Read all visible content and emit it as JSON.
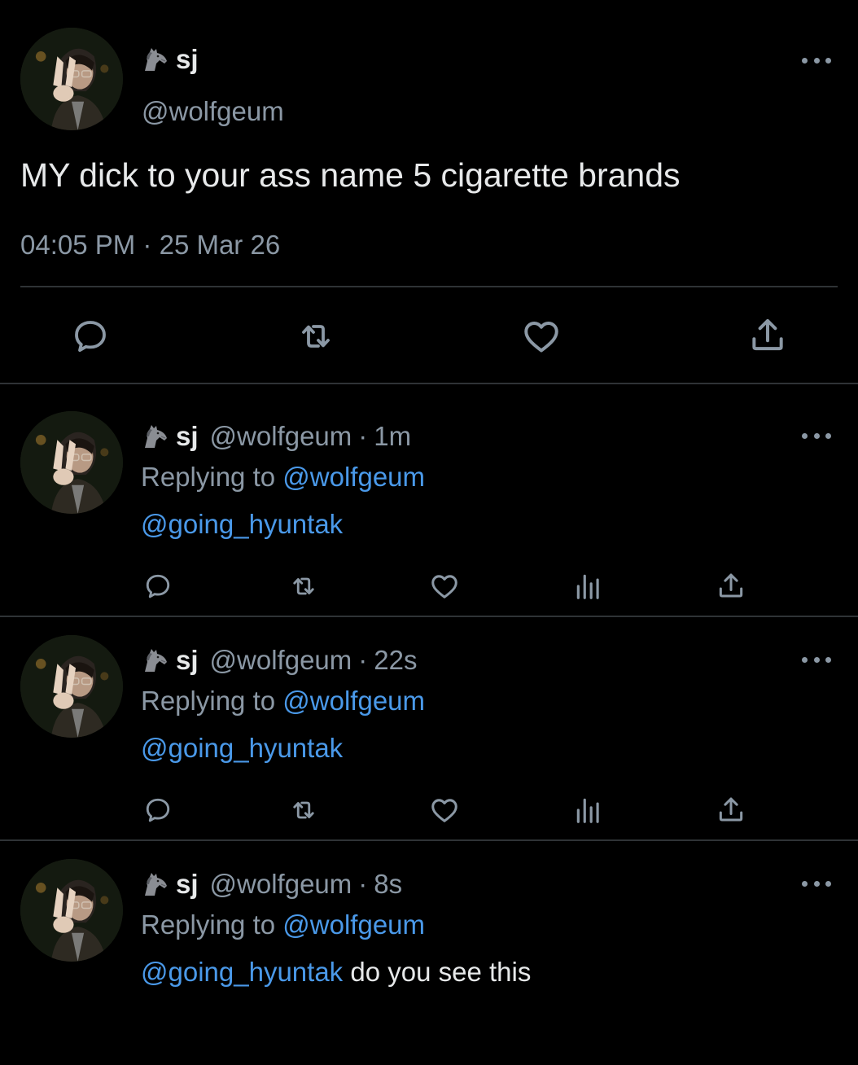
{
  "main_tweet": {
    "display_name": "sj",
    "handle": "@wolfgeum",
    "text": "MY dick to your ass name 5 cigarette brands",
    "time": "04:05 PM",
    "separator": "·",
    "date": "25 Mar 26",
    "actions": [
      "reply-icon",
      "retweet-icon",
      "heart-icon",
      "share-icon"
    ]
  },
  "replies": [
    {
      "display_name": "sj",
      "handle": "@wolfgeum",
      "separator": "·",
      "time_ago": "1m",
      "replying_prefix": "Replying to",
      "replying_to": "@wolfgeum",
      "mention": "@going_hyuntak",
      "body": ""
    },
    {
      "display_name": "sj",
      "handle": "@wolfgeum",
      "separator": "·",
      "time_ago": "22s",
      "replying_prefix": "Replying to",
      "replying_to": "@wolfgeum",
      "mention": "@going_hyuntak",
      "body": ""
    },
    {
      "display_name": "sj",
      "handle": "@wolfgeum",
      "separator": "·",
      "time_ago": "8s",
      "replying_prefix": "Replying to",
      "replying_to": "@wolfgeum",
      "mention": "@going_hyuntak",
      "body": " do you see this"
    }
  ],
  "reply_actions": [
    "reply-icon",
    "retweet-icon",
    "heart-icon",
    "analytics-icon",
    "share-icon"
  ],
  "colors": {
    "background": "#000000",
    "text": "#e7e9ea",
    "secondary_text": "#8b98a5",
    "link": "#4a99e9",
    "divider": "#2f3336"
  }
}
